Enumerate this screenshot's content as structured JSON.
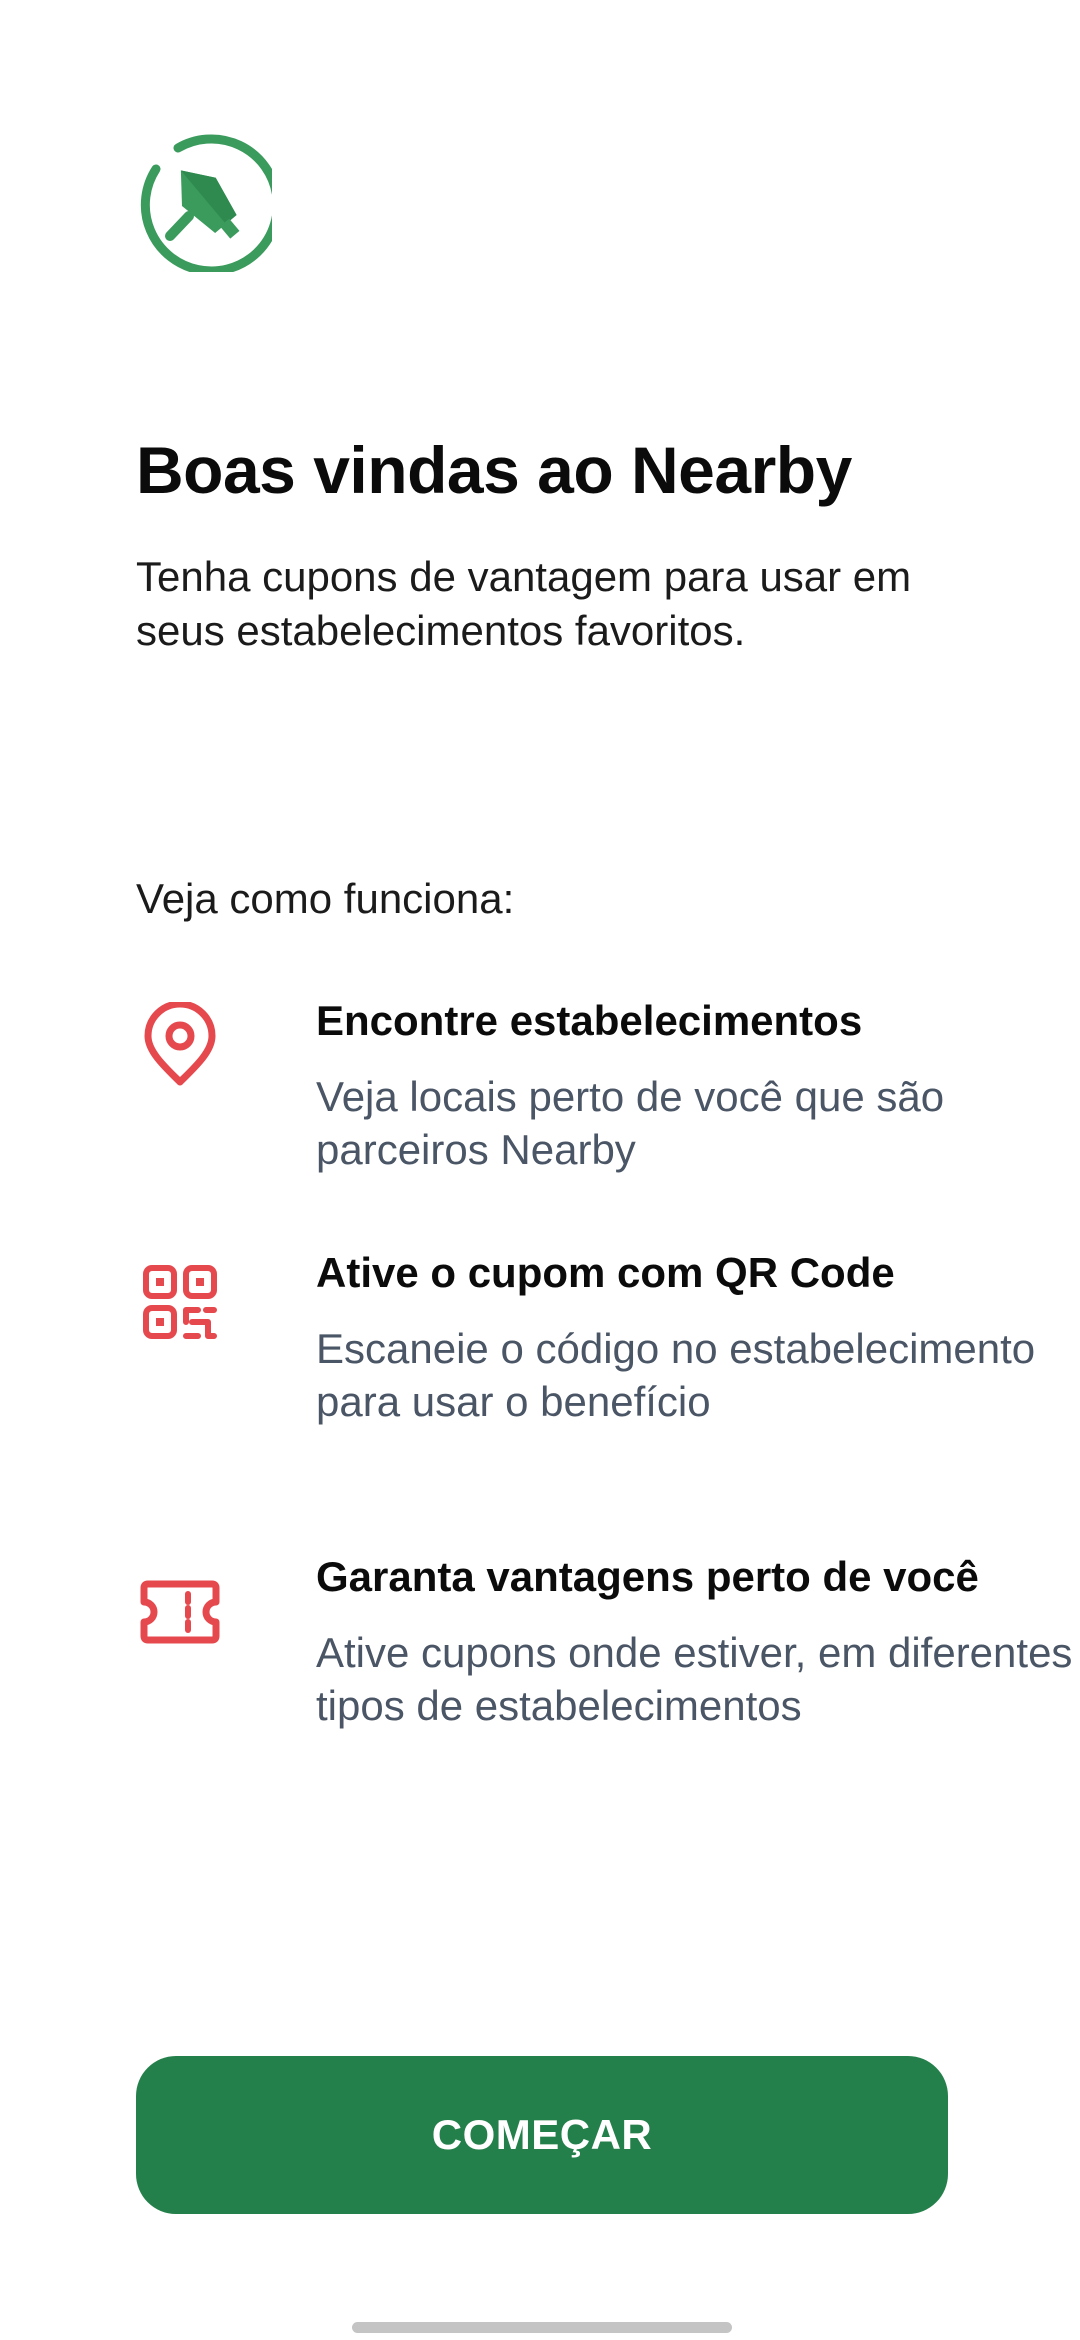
{
  "brand": {
    "logo_icon": "map-pin-tag-logo-icon",
    "accent_color": "#3a9b5c",
    "button_color": "#24804a",
    "icon_color": "#e5484d"
  },
  "welcome": {
    "title": "Boas vindas ao Nearby",
    "subtitle": "Tenha cupons de vantagem para usar em seus estabelecimentos favoritos."
  },
  "how_it_works": {
    "label": "Veja como funciona:",
    "steps": [
      {
        "icon": "map-pin-icon",
        "title": "Encontre estabelecimentos",
        "description": "Veja locais perto de você que são parceiros Nearby"
      },
      {
        "icon": "qr-code-icon",
        "title": "Ative o cupom com QR Code",
        "description": "Escaneie o código no estabelecimento para usar o benefício"
      },
      {
        "icon": "ticket-icon",
        "title": "Garanta vantagens perto de você",
        "description": "Ative cupons onde estiver, em diferentes tipos de estabelecimentos"
      }
    ]
  },
  "actions": {
    "start_label": "COMEÇAR"
  }
}
